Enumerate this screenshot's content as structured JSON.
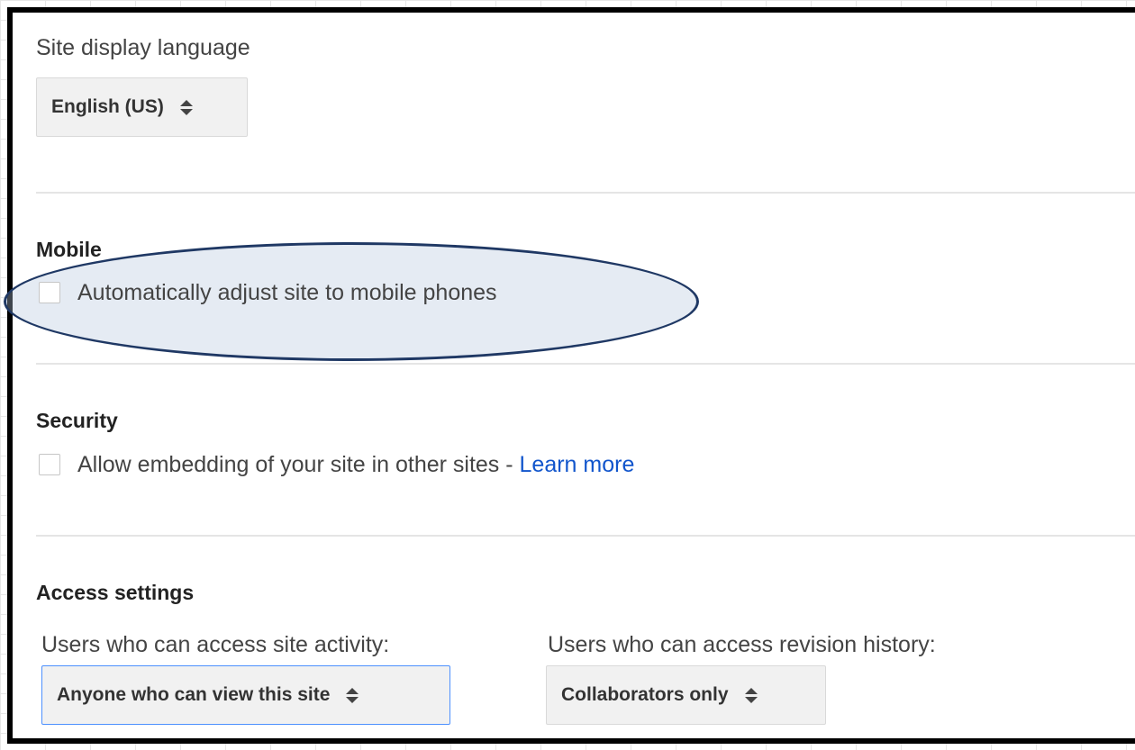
{
  "language": {
    "heading": "Site display language",
    "selected": "English (US)"
  },
  "mobile": {
    "heading": "Mobile",
    "checkbox_label": "Automatically adjust site to mobile phones",
    "checked": false
  },
  "security": {
    "heading": "Security",
    "checkbox_label": "Allow embedding of your site in other sites - ",
    "link_label": "Learn more",
    "checked": false
  },
  "access": {
    "heading": "Access settings",
    "activity_label": "Users who can access site activity:",
    "activity_selected": "Anyone who can view this site",
    "revision_label": "Users who can access revision history:",
    "revision_selected": "Collaborators only"
  },
  "colors": {
    "link": "#1155cc",
    "highlight_outline": "#1f3864",
    "focus_border": "#4d90fe"
  },
  "icons": {
    "select_arrows": "up-down-caret-icon"
  }
}
